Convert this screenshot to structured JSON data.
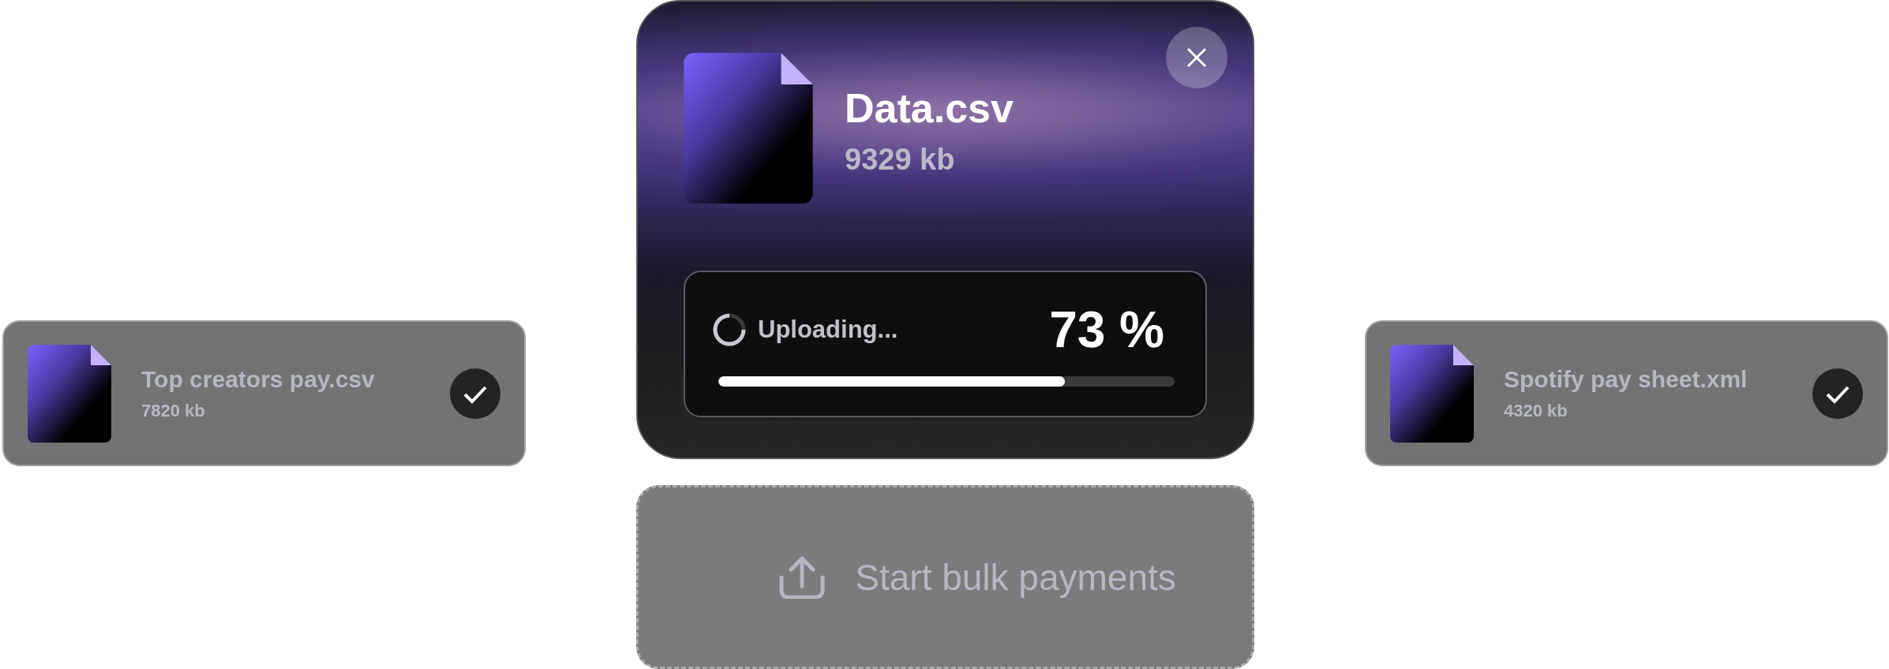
{
  "files": [
    {
      "name": "Top creators pay.csv",
      "size": "7820 kb",
      "done": true
    },
    {
      "name": "Spotify pay sheet.xml",
      "size": "4320 kb",
      "done": true
    }
  ],
  "upload": {
    "name": "Data.csv",
    "size": "9329 kb",
    "status": "Uploading...",
    "percent": "73 %",
    "level": 0.76
  },
  "action": {
    "label": "Start bulk payments"
  }
}
